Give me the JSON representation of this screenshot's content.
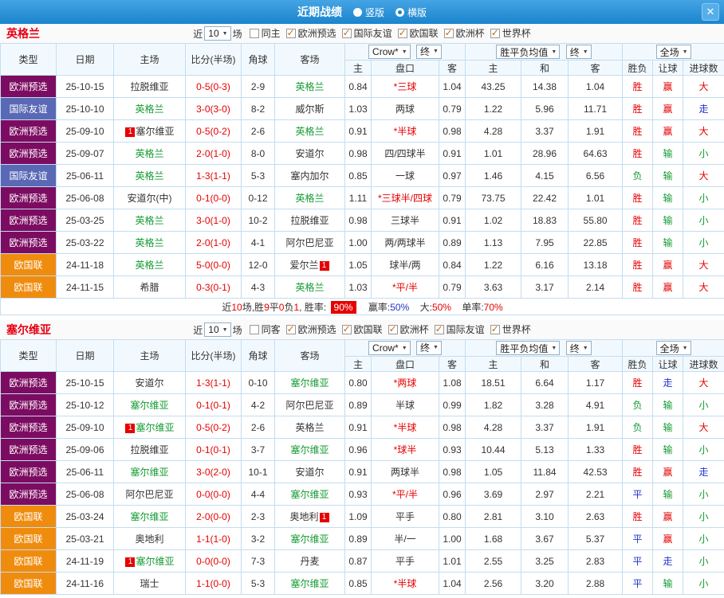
{
  "colors": {
    "title_bar": "#1a84cd",
    "type_euro_qualifiers": "#7c0c61",
    "type_friendly": "#5a69b5",
    "type_nations_league": "#ef8c0e",
    "focal_team_green": "#149b32",
    "result_red": "#e60000",
    "result_green": "#149b32",
    "result_blue": "#2233cc",
    "badge_red": "#e60000"
  },
  "title_bar": {
    "title": "近期战绩",
    "view_vertical": "竖版",
    "view_horizontal": "横版",
    "close_icon": "✕"
  },
  "table_headers": {
    "type": "类型",
    "date": "日期",
    "home": "主场",
    "score": "比分(半场)",
    "corners": "角球",
    "away": "客场",
    "odds_source_select": "Crow*",
    "odds_time_select": "终",
    "odds_home": "主",
    "odds_line": "盘口",
    "odds_away": "客",
    "avg_select": "胜平负均值",
    "avg_time_select": "终",
    "avg_home": "主",
    "avg_draw": "和",
    "avg_away": "客",
    "scope_select": "全场",
    "result_outcome": "胜负",
    "result_handicap": "让球",
    "result_goals": "进球数"
  },
  "england": {
    "team": "英格兰",
    "filter": {
      "near": "近",
      "count": "10",
      "games": "场",
      "checks": [
        {
          "label": "同主",
          "checked": false
        },
        {
          "label": "欧洲预选",
          "checked": true
        },
        {
          "label": "国际友谊",
          "checked": true
        },
        {
          "label": "欧国联",
          "checked": true
        },
        {
          "label": "欧洲杯",
          "checked": true
        },
        {
          "label": "世界杯",
          "checked": true
        }
      ]
    },
    "rows": [
      {
        "type": "欧洲预选",
        "date": "25-10-15",
        "home": {
          "name": "拉脱维亚"
        },
        "score": "0-5(0-3)",
        "corners": "2-9",
        "away": {
          "name": "英格兰",
          "focal": true
        },
        "odds_home": "0.84",
        "line": "*三球",
        "odds_away": "1.04",
        "avg_home": "43.25",
        "avg_draw": "14.38",
        "avg_away": "1.04",
        "outcome": "胜",
        "hcp": "赢",
        "goals": "大"
      },
      {
        "type": "国际友谊",
        "date": "25-10-10",
        "home": {
          "name": "英格兰",
          "focal": true
        },
        "score": "3-0(3-0)",
        "corners": "8-2",
        "away": {
          "name": "威尔斯"
        },
        "odds_home": "1.03",
        "line": "两球",
        "odds_away": "0.79",
        "avg_home": "1.22",
        "avg_draw": "5.96",
        "avg_away": "11.71",
        "outcome": "胜",
        "hcp": "赢",
        "goals": "走"
      },
      {
        "type": "欧洲预选",
        "date": "25-09-10",
        "home": {
          "name": "塞尔维亚",
          "badge": "1",
          "badge_pos": "pre"
        },
        "score": "0-5(0-2)",
        "corners": "2-6",
        "away": {
          "name": "英格兰",
          "focal": true
        },
        "odds_home": "0.91",
        "line": "*半球",
        "odds_away": "0.98",
        "avg_home": "4.28",
        "avg_draw": "3.37",
        "avg_away": "1.91",
        "outcome": "胜",
        "hcp": "赢",
        "goals": "大"
      },
      {
        "type": "欧洲预选",
        "date": "25-09-07",
        "home": {
          "name": "英格兰",
          "focal": true
        },
        "score": "2-0(1-0)",
        "corners": "8-0",
        "away": {
          "name": "安道尔"
        },
        "odds_home": "0.98",
        "line": "四/四球半",
        "odds_away": "0.91",
        "avg_home": "1.01",
        "avg_draw": "28.96",
        "avg_away": "64.63",
        "outcome": "胜",
        "hcp": "输",
        "goals": "小"
      },
      {
        "type": "国际友谊",
        "date": "25-06-11",
        "home": {
          "name": "英格兰",
          "focal": true
        },
        "score": "1-3(1-1)",
        "corners": "5-3",
        "away": {
          "name": "塞内加尔"
        },
        "odds_home": "0.85",
        "line": "一球",
        "odds_away": "0.97",
        "avg_home": "1.46",
        "avg_draw": "4.15",
        "avg_away": "6.56",
        "outcome": "负",
        "hcp": "输",
        "goals": "大"
      },
      {
        "type": "欧洲预选",
        "date": "25-06-08",
        "home": {
          "name": "安道尔(中)"
        },
        "score": "0-1(0-0)",
        "corners": "0-12",
        "away": {
          "name": "英格兰",
          "focal": true
        },
        "odds_home": "1.11",
        "line": "*三球半/四球",
        "odds_away": "0.79",
        "avg_home": "73.75",
        "avg_draw": "22.42",
        "avg_away": "1.01",
        "outcome": "胜",
        "hcp": "输",
        "goals": "小"
      },
      {
        "type": "欧洲预选",
        "date": "25-03-25",
        "home": {
          "name": "英格兰",
          "focal": true
        },
        "score": "3-0(1-0)",
        "corners": "10-2",
        "away": {
          "name": "拉脱维亚"
        },
        "odds_home": "0.98",
        "line": "三球半",
        "odds_away": "0.91",
        "avg_home": "1.02",
        "avg_draw": "18.83",
        "avg_away": "55.80",
        "outcome": "胜",
        "hcp": "输",
        "goals": "小"
      },
      {
        "type": "欧洲预选",
        "date": "25-03-22",
        "home": {
          "name": "英格兰",
          "focal": true
        },
        "score": "2-0(1-0)",
        "corners": "4-1",
        "away": {
          "name": "阿尔巴尼亚"
        },
        "odds_home": "1.00",
        "line": "两/两球半",
        "odds_away": "0.89",
        "avg_home": "1.13",
        "avg_draw": "7.95",
        "avg_away": "22.85",
        "outcome": "胜",
        "hcp": "输",
        "goals": "小"
      },
      {
        "type": "欧国联",
        "date": "24-11-18",
        "home": {
          "name": "英格兰",
          "focal": true
        },
        "score": "5-0(0-0)",
        "corners": "12-0",
        "away": {
          "name": "爱尔兰",
          "badge": "1",
          "badge_pos": "post"
        },
        "odds_home": "1.05",
        "line": "球半/两",
        "odds_away": "0.84",
        "avg_home": "1.22",
        "avg_draw": "6.16",
        "avg_away": "13.18",
        "outcome": "胜",
        "hcp": "赢",
        "goals": "大"
      },
      {
        "type": "欧国联",
        "date": "24-11-15",
        "home": {
          "name": "希腊"
        },
        "score": "0-3(0-1)",
        "corners": "4-3",
        "away": {
          "name": "英格兰",
          "focal": true
        },
        "odds_home": "1.03",
        "line": "*平/半",
        "odds_away": "0.79",
        "avg_home": "3.63",
        "avg_draw": "3.17",
        "avg_away": "2.14",
        "outcome": "胜",
        "hcp": "赢",
        "goals": "大"
      }
    ],
    "summary": {
      "s1": "近",
      "games": "10",
      "s2": "场,胜",
      "w": "9",
      "s3": "平",
      "d": "0",
      "s4": "负",
      "l": "1",
      "s5": ", 胜率:",
      "win_rate": "90%",
      "s6": "赢率:",
      "hcp_rate": "50%",
      "s7": "大:",
      "big_rate": "50%",
      "s8": "单率:",
      "odd_rate": "70%"
    }
  },
  "serbia": {
    "team": "塞尔维亚",
    "filter": {
      "near": "近",
      "count": "10",
      "games": "场",
      "checks": [
        {
          "label": "同客",
          "checked": false
        },
        {
          "label": "欧洲预选",
          "checked": true
        },
        {
          "label": "欧国联",
          "checked": true
        },
        {
          "label": "欧洲杯",
          "checked": true
        },
        {
          "label": "国际友谊",
          "checked": true
        },
        {
          "label": "世界杯",
          "checked": true
        }
      ]
    },
    "rows": [
      {
        "type": "欧洲预选",
        "date": "25-10-15",
        "home": {
          "name": "安道尔"
        },
        "score": "1-3(1-1)",
        "corners": "0-10",
        "away": {
          "name": "塞尔维亚",
          "focal": true
        },
        "odds_home": "0.80",
        "line": "*两球",
        "odds_away": "1.08",
        "avg_home": "18.51",
        "avg_draw": "6.64",
        "avg_away": "1.17",
        "outcome": "胜",
        "hcp": "走",
        "goals": "大"
      },
      {
        "type": "欧洲预选",
        "date": "25-10-12",
        "home": {
          "name": "塞尔维亚",
          "focal": true
        },
        "score": "0-1(0-1)",
        "corners": "4-2",
        "away": {
          "name": "阿尔巴尼亚"
        },
        "odds_home": "0.89",
        "line": "半球",
        "odds_away": "0.99",
        "avg_home": "1.82",
        "avg_draw": "3.28",
        "avg_away": "4.91",
        "outcome": "负",
        "hcp": "输",
        "goals": "小"
      },
      {
        "type": "欧洲预选",
        "date": "25-09-10",
        "home": {
          "name": "塞尔维亚",
          "focal": true,
          "badge": "1",
          "badge_pos": "pre"
        },
        "score": "0-5(0-2)",
        "corners": "2-6",
        "away": {
          "name": "英格兰"
        },
        "odds_home": "0.91",
        "line": "*半球",
        "odds_away": "0.98",
        "avg_home": "4.28",
        "avg_draw": "3.37",
        "avg_away": "1.91",
        "outcome": "负",
        "hcp": "输",
        "goals": "大"
      },
      {
        "type": "欧洲预选",
        "date": "25-09-06",
        "home": {
          "name": "拉脱维亚"
        },
        "score": "0-1(0-1)",
        "corners": "3-7",
        "away": {
          "name": "塞尔维亚",
          "focal": true
        },
        "odds_home": "0.96",
        "line": "*球半",
        "odds_away": "0.93",
        "avg_home": "10.44",
        "avg_draw": "5.13",
        "avg_away": "1.33",
        "outcome": "胜",
        "hcp": "输",
        "goals": "小"
      },
      {
        "type": "欧洲预选",
        "date": "25-06-11",
        "home": {
          "name": "塞尔维亚",
          "focal": true
        },
        "score": "3-0(2-0)",
        "corners": "10-1",
        "away": {
          "name": "安道尔"
        },
        "odds_home": "0.91",
        "line": "两球半",
        "odds_away": "0.98",
        "avg_home": "1.05",
        "avg_draw": "11.84",
        "avg_away": "42.53",
        "outcome": "胜",
        "hcp": "赢",
        "goals": "走"
      },
      {
        "type": "欧洲预选",
        "date": "25-06-08",
        "home": {
          "name": "阿尔巴尼亚"
        },
        "score": "0-0(0-0)",
        "corners": "4-4",
        "away": {
          "name": "塞尔维亚",
          "focal": true
        },
        "odds_home": "0.93",
        "line": "*平/半",
        "odds_away": "0.96",
        "avg_home": "3.69",
        "avg_draw": "2.97",
        "avg_away": "2.21",
        "outcome": "平",
        "hcp": "输",
        "goals": "小"
      },
      {
        "type": "欧国联",
        "date": "25-03-24",
        "home": {
          "name": "塞尔维亚",
          "focal": true
        },
        "score": "2-0(0-0)",
        "corners": "2-3",
        "away": {
          "name": "奥地利",
          "badge": "1",
          "badge_pos": "post"
        },
        "odds_home": "1.09",
        "line": "平手",
        "odds_away": "0.80",
        "avg_home": "2.81",
        "avg_draw": "3.10",
        "avg_away": "2.63",
        "outcome": "胜",
        "hcp": "赢",
        "goals": "小"
      },
      {
        "type": "欧国联",
        "date": "25-03-21",
        "home": {
          "name": "奥地利"
        },
        "score": "1-1(1-0)",
        "corners": "3-2",
        "away": {
          "name": "塞尔维亚",
          "focal": true
        },
        "odds_home": "0.89",
        "line": "半/一",
        "odds_away": "1.00",
        "avg_home": "1.68",
        "avg_draw": "3.67",
        "avg_away": "5.37",
        "outcome": "平",
        "hcp": "赢",
        "goals": "小"
      },
      {
        "type": "欧国联",
        "date": "24-11-19",
        "home": {
          "name": "塞尔维亚",
          "focal": true,
          "badge": "1",
          "badge_pos": "pre"
        },
        "score": "0-0(0-0)",
        "corners": "7-3",
        "away": {
          "name": "丹麦"
        },
        "odds_home": "0.87",
        "line": "平手",
        "odds_away": "1.01",
        "avg_home": "2.55",
        "avg_draw": "3.25",
        "avg_away": "2.83",
        "outcome": "平",
        "hcp": "走",
        "goals": "小"
      },
      {
        "type": "欧国联",
        "date": "24-11-16",
        "home": {
          "name": "瑞士"
        },
        "score": "1-1(0-0)",
        "corners": "5-3",
        "away": {
          "name": "塞尔维亚",
          "focal": true
        },
        "odds_home": "0.85",
        "line": "*半球",
        "odds_away": "1.04",
        "avg_home": "2.56",
        "avg_draw": "3.20",
        "avg_away": "2.88",
        "outcome": "平",
        "hcp": "输",
        "goals": "小"
      }
    ]
  }
}
